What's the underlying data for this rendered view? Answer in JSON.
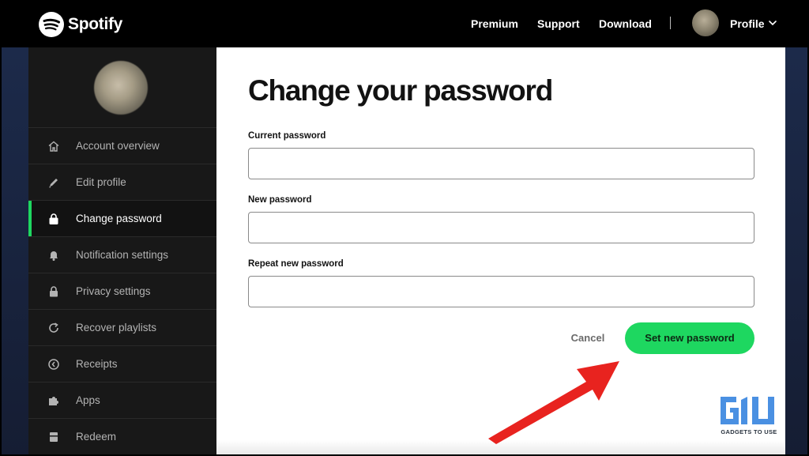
{
  "header": {
    "brand": "Spotify",
    "nav": {
      "premium": "Premium",
      "support": "Support",
      "download": "Download",
      "profile": "Profile"
    }
  },
  "sidebar": {
    "items": [
      {
        "label": "Account overview",
        "icon": "home-icon"
      },
      {
        "label": "Edit profile",
        "icon": "pencil-icon"
      },
      {
        "label": "Change password",
        "icon": "lock-icon",
        "active": true
      },
      {
        "label": "Notification settings",
        "icon": "bell-icon"
      },
      {
        "label": "Privacy settings",
        "icon": "lock-icon"
      },
      {
        "label": "Recover playlists",
        "icon": "refresh-icon"
      },
      {
        "label": "Receipts",
        "icon": "clock-icon"
      },
      {
        "label": "Apps",
        "icon": "puzzle-icon"
      },
      {
        "label": "Redeem",
        "icon": "card-icon"
      }
    ]
  },
  "main": {
    "title": "Change your password",
    "fields": {
      "current": {
        "label": "Current password",
        "value": ""
      },
      "new": {
        "label": "New password",
        "value": ""
      },
      "repeat": {
        "label": "Repeat new password",
        "value": ""
      }
    },
    "cancel_label": "Cancel",
    "submit_label": "Set new password"
  },
  "watermark": {
    "logo": "G1U",
    "text": "GADGETS TO USE"
  },
  "colors": {
    "accent": "#1ed760",
    "nav_bg": "#000000",
    "sidebar_bg": "#181818",
    "arrow": "#e8231f"
  }
}
